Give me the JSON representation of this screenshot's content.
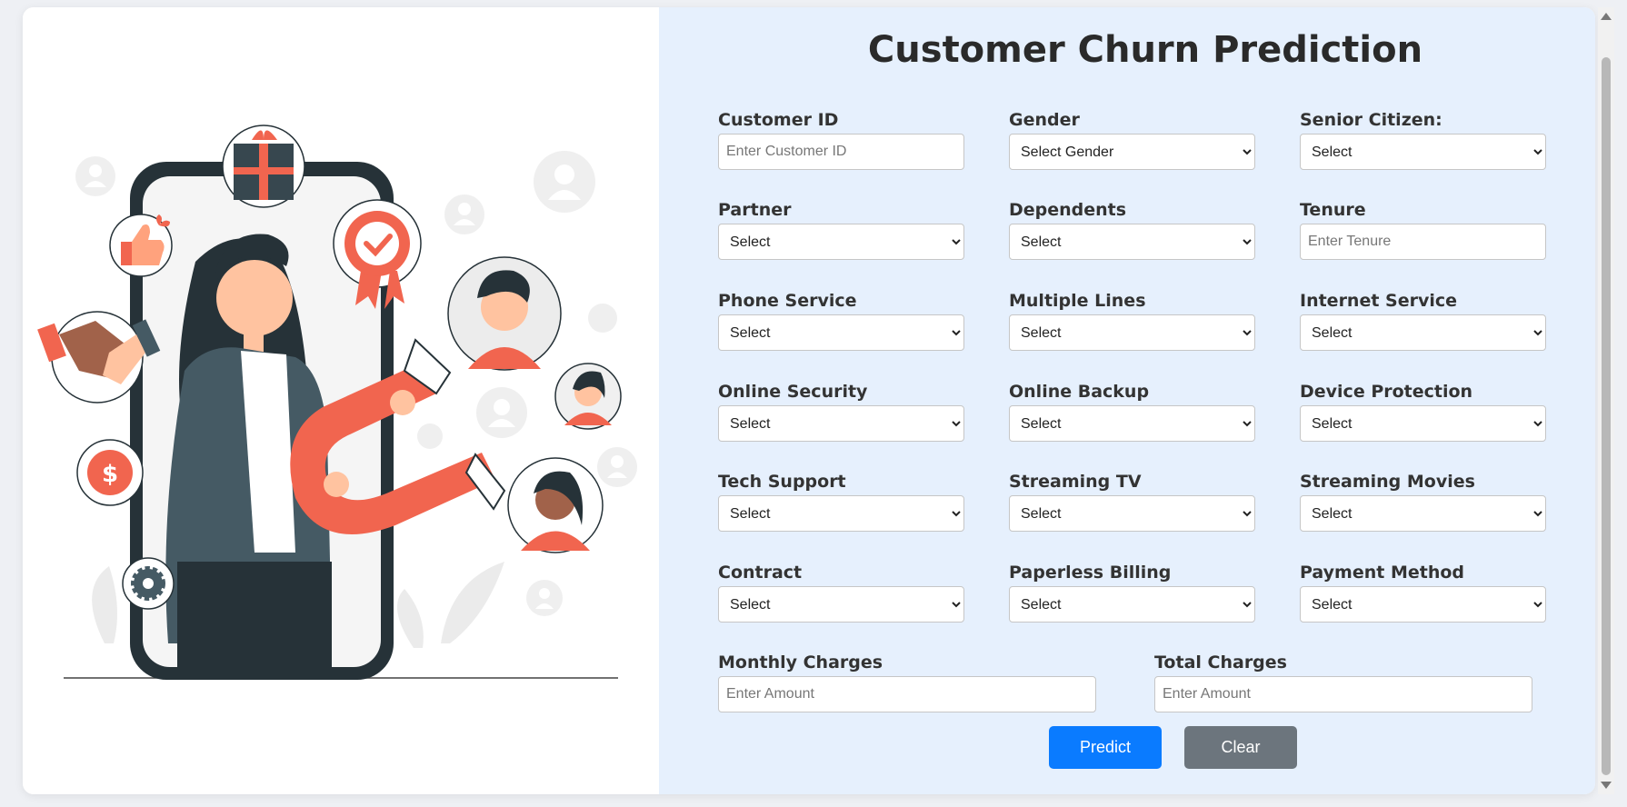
{
  "page": {
    "title": "Customer Churn Prediction",
    "illustration_name": "customer-attraction-illustration"
  },
  "form": {
    "fields": [
      {
        "id": "customer_id",
        "label": "Customer ID",
        "type": "input",
        "placeholder": "Enter Customer ID",
        "value": ""
      },
      {
        "id": "gender",
        "label": "Gender",
        "type": "select",
        "value": "Select Gender"
      },
      {
        "id": "senior_citizen",
        "label": "Senior Citizen:",
        "type": "select",
        "value": "Select"
      },
      {
        "id": "partner",
        "label": "Partner",
        "type": "select",
        "value": "Select"
      },
      {
        "id": "dependents",
        "label": "Dependents",
        "type": "select",
        "value": "Select"
      },
      {
        "id": "tenure",
        "label": "Tenure",
        "type": "input",
        "placeholder": "Enter Tenure",
        "value": ""
      },
      {
        "id": "phone_service",
        "label": "Phone Service",
        "type": "select",
        "value": "Select"
      },
      {
        "id": "multiple_lines",
        "label": "Multiple Lines",
        "type": "select",
        "value": "Select"
      },
      {
        "id": "internet_service",
        "label": "Internet Service",
        "type": "select",
        "value": "Select"
      },
      {
        "id": "online_security",
        "label": "Online Security",
        "type": "select",
        "value": "Select"
      },
      {
        "id": "online_backup",
        "label": "Online Backup",
        "type": "select",
        "value": "Select"
      },
      {
        "id": "device_protection",
        "label": "Device Protection",
        "type": "select",
        "value": "Select"
      },
      {
        "id": "tech_support",
        "label": "Tech Support",
        "type": "select",
        "value": "Select"
      },
      {
        "id": "streaming_tv",
        "label": "Streaming TV",
        "type": "select",
        "value": "Select"
      },
      {
        "id": "streaming_movies",
        "label": "Streaming Movies",
        "type": "select",
        "value": "Select"
      },
      {
        "id": "contract",
        "label": "Contract",
        "type": "select",
        "value": "Select"
      },
      {
        "id": "paperless_billing",
        "label": "Paperless Billing",
        "type": "select",
        "value": "Select"
      },
      {
        "id": "payment_method",
        "label": "Payment Method",
        "type": "select",
        "value": "Select"
      },
      {
        "id": "monthly_charges",
        "label": "Monthly Charges",
        "type": "input",
        "placeholder": "Enter Amount",
        "value": ""
      },
      {
        "id": "total_charges",
        "label": "Total Charges",
        "type": "input",
        "placeholder": "Enter Amount",
        "value": ""
      }
    ]
  },
  "buttons": {
    "predict_label": "Predict",
    "clear_label": "Clear"
  },
  "colors": {
    "primary": "#0a7bff",
    "secondary": "#6c757d",
    "form_background": "#e6f0fd",
    "accent_coral": "#f1654f",
    "dark_teal": "#263238"
  }
}
